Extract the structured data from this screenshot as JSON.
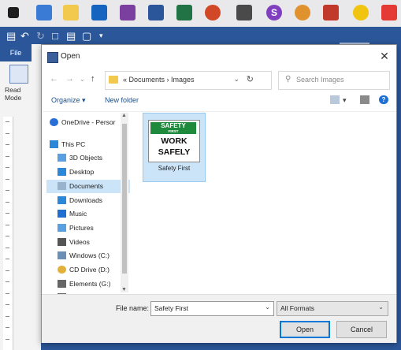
{
  "taskbar": {
    "apps": [
      {
        "icon": "start-windows-icon",
        "color": "#1e1e1e"
      },
      {
        "icon": "edge-icon",
        "color": "#3a7bd5"
      },
      {
        "icon": "file-explorer-icon",
        "color": "#f2c94c"
      },
      {
        "icon": "outlook-icon",
        "color": "#1565c0"
      },
      {
        "icon": "onenote-icon",
        "color": "#7b3fa0"
      },
      {
        "icon": "word-icon",
        "color": "#2b579a"
      },
      {
        "icon": "excel-icon",
        "color": "#217346"
      },
      {
        "icon": "powerpoint-icon",
        "color": "#d24726"
      },
      {
        "icon": "calculator-icon",
        "color": "#4a4a4a"
      },
      {
        "icon": "skype-icon",
        "color": "#7f3fbf"
      },
      {
        "icon": "paint-icon",
        "color": "#e0922f"
      },
      {
        "icon": "snipping-icon",
        "color": "#c0392b"
      },
      {
        "icon": "norton-icon",
        "color": "#f1c40f"
      },
      {
        "icon": "pdf-icon",
        "color": "#e53935"
      }
    ],
    "skype_letter": "S"
  },
  "word": {
    "file_tab": "File",
    "read_mode_label": "Read Mode"
  },
  "dialog": {
    "title": "Open",
    "breadcrumb": "« Documents › Images",
    "search_placeholder": "Search Images",
    "organize_label": "Organize ▾",
    "new_folder_label": "New folder",
    "nav_items": [
      {
        "label": "OneDrive - Persor",
        "icon": "onedrive-icon",
        "color": "#2a6ed8"
      },
      {
        "label": "This PC",
        "icon": "this-pc-icon",
        "color": "#2b88d8"
      },
      {
        "label": "3D Objects",
        "icon": "3d-objects-icon",
        "color": "#5aa0e0"
      },
      {
        "label": "Desktop",
        "icon": "desktop-icon",
        "color": "#2b88d8"
      },
      {
        "label": "Documents",
        "icon": "documents-icon",
        "color": "#9ab3cc",
        "selected": true
      },
      {
        "label": "Downloads",
        "icon": "downloads-icon",
        "color": "#2b88d8"
      },
      {
        "label": "Music",
        "icon": "music-icon",
        "color": "#1f6fd1"
      },
      {
        "label": "Pictures",
        "icon": "pictures-icon",
        "color": "#5aa0e0"
      },
      {
        "label": "Videos",
        "icon": "videos-icon",
        "color": "#555555"
      },
      {
        "label": "Windows (C:)",
        "icon": "windows-drive-icon",
        "color": "#6c8fb5"
      },
      {
        "label": "CD Drive (D:)",
        "icon": "cd-drive-icon",
        "color": "#e2b13c"
      },
      {
        "label": "Elements (G:)",
        "icon": "elements-drive-icon",
        "color": "#666666"
      },
      {
        "label": "Elements (G:)",
        "icon": "elements-drive-icon",
        "color": "#666666"
      }
    ],
    "file": {
      "name": "Safety First",
      "thumbnail": {
        "top": "SAFETY",
        "top_small": "FIRST",
        "line1": "WORK",
        "line2": "SAFELY"
      }
    },
    "file_name_label": "File name:",
    "file_name_value": "Safety First",
    "file_type_value": "All Formats",
    "open_label": "Open",
    "cancel_label": "Cancel"
  }
}
